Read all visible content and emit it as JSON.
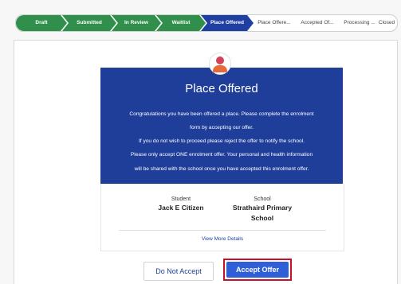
{
  "stepper": {
    "steps": [
      {
        "label": "Draft",
        "state": "done"
      },
      {
        "label": "Submitted",
        "state": "done"
      },
      {
        "label": "In Review",
        "state": "done"
      },
      {
        "label": "Waitlist",
        "state": "done"
      },
      {
        "label": "Place Offered",
        "state": "current"
      },
      {
        "label": "Place Offere...",
        "state": "todo"
      },
      {
        "label": "Accepted Of...",
        "state": "todo"
      },
      {
        "label": "Processing ...",
        "state": "todo"
      },
      {
        "label": "Closed",
        "state": "todo"
      }
    ]
  },
  "offer": {
    "title": "Place Offered",
    "messages": [
      "Congratulations you have been offered a place. Please complete the enrolment",
      "form by accepting our offer.",
      "If you do not wish to proceed please reject the offer to notify the school.",
      "Please only accept ONE enrolment offer. Your personal and health information",
      "will be shared with the school once you have accepted this enrolment offer."
    ],
    "avatar_icon": "person-avatar-icon"
  },
  "details": {
    "student_label": "Student",
    "student_value": "Jack E Citizen",
    "school_label": "School",
    "school_value_line1": "Strathaird Primary",
    "school_value_line2": "School",
    "more_link": "View More Details"
  },
  "actions": {
    "decline_label": "Do Not Accept",
    "accept_label": "Accept Offer"
  },
  "colors": {
    "done": "#2f8f4b",
    "current": "#1f3fa3",
    "card": "#1f3e9a",
    "accept": "#2f5fd6",
    "highlight": "#c8102e"
  }
}
